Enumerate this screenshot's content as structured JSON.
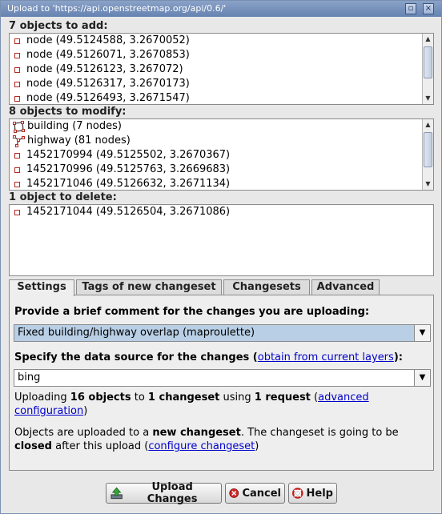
{
  "window": {
    "title": "Upload to 'https://api.openstreetmap.org/api/0.6/'"
  },
  "add": {
    "label": "7 objects to add:",
    "items": [
      "node (49.5124588, 3.2670052)",
      "node (49.5126071, 3.2670853)",
      "node (49.5126123, 3.267072)",
      "node (49.5126317, 3.2670173)",
      "node (49.5126493, 3.2671547)"
    ]
  },
  "modify": {
    "label": "8 objects to modify:",
    "items": [
      {
        "icon": "building",
        "text": "building (7 nodes)"
      },
      {
        "icon": "way",
        "text": "highway (81 nodes)"
      },
      {
        "icon": "node",
        "text": "1452170994 (49.5125502, 3.2670367)"
      },
      {
        "icon": "node",
        "text": "1452170996 (49.5125763, 3.2669683)"
      },
      {
        "icon": "node",
        "text": "1452171046 (49.5126632, 3.2671134)"
      }
    ]
  },
  "delete": {
    "label": "1 object to delete:",
    "items": [
      "1452171044 (49.5126504, 3.2671086)"
    ]
  },
  "tabs": [
    "Settings",
    "Tags of new changeset",
    "Changesets",
    "Advanced"
  ],
  "settings": {
    "comment_label": "Provide a brief comment for the changes you are uploading:",
    "comment_value": "Fixed building/highway overlap (maproulette)",
    "source_label_pre": "Specify the data source for the changes (",
    "source_link": "obtain from current layers",
    "source_label_post": "):",
    "source_value": "bing",
    "summary": {
      "t1": "Uploading ",
      "b1": "16 objects",
      "t2": " to ",
      "b2": "1 changeset",
      "t3": " using ",
      "b3": "1 request",
      "t4": " (",
      "link1a": "advanced",
      "link1b": "configuration",
      "t5": ")"
    },
    "info": {
      "t1": "Objects are uploaded to a ",
      "b1": "new changeset",
      "t2": ". The changeset is going to be",
      "b2": "closed",
      "t3": " after this upload (",
      "link": "configure changeset",
      "t4": ")"
    }
  },
  "buttons": {
    "upload": "Upload Changes",
    "cancel": "Cancel",
    "help": "Help"
  },
  "colors": {
    "titlebar": "#7892bd",
    "node_icon": "#b42a1e",
    "selection": "#b8cfe5",
    "link": "#0000cc"
  }
}
